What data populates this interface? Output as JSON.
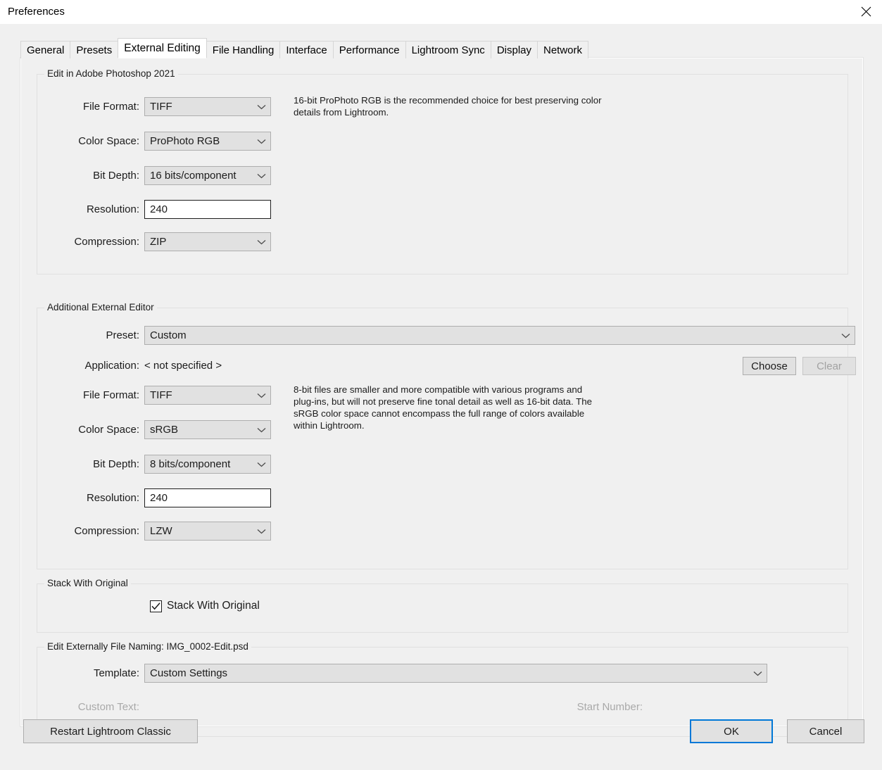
{
  "window": {
    "title": "Preferences",
    "close_icon": "close-icon"
  },
  "tabs": [
    {
      "label": "General",
      "active": false
    },
    {
      "label": "Presets",
      "active": false
    },
    {
      "label": "External Editing",
      "active": true
    },
    {
      "label": "File Handling",
      "active": false
    },
    {
      "label": "Interface",
      "active": false
    },
    {
      "label": "Performance",
      "active": false
    },
    {
      "label": "Lightroom Sync",
      "active": false
    },
    {
      "label": "Display",
      "active": false
    },
    {
      "label": "Network",
      "active": false
    }
  ],
  "photoshop_group": {
    "title": "Edit in Adobe Photoshop 2021",
    "description": "16-bit ProPhoto RGB is the recommended choice for best preserving color details from Lightroom.",
    "file_format": {
      "label": "File Format:",
      "value": "TIFF"
    },
    "color_space": {
      "label": "Color Space:",
      "value": "ProPhoto RGB"
    },
    "bit_depth": {
      "label": "Bit Depth:",
      "value": "16 bits/component"
    },
    "resolution": {
      "label": "Resolution:",
      "value": "240"
    },
    "compression": {
      "label": "Compression:",
      "value": "ZIP"
    }
  },
  "additional_editor_group": {
    "title": "Additional External Editor",
    "description": "8-bit files are smaller and more compatible with various programs and plug-ins, but will not preserve fine tonal detail as well as 16-bit data. The sRGB color space cannot encompass the full range of colors available within Lightroom.",
    "preset": {
      "label": "Preset:",
      "value": "Custom"
    },
    "application": {
      "label": "Application:",
      "value": "< not specified >"
    },
    "choose_button": "Choose",
    "clear_button": "Clear",
    "file_format": {
      "label": "File Format:",
      "value": "TIFF"
    },
    "color_space": {
      "label": "Color Space:",
      "value": "sRGB"
    },
    "bit_depth": {
      "label": "Bit Depth:",
      "value": "8 bits/component"
    },
    "resolution": {
      "label": "Resolution:",
      "value": "240"
    },
    "compression": {
      "label": "Compression:",
      "value": "LZW"
    }
  },
  "stack_group": {
    "title": "Stack With Original",
    "checkbox_label": "Stack With Original",
    "checked": true
  },
  "naming_group": {
    "title": "Edit Externally File Naming:  IMG_0002-Edit.psd",
    "template": {
      "label": "Template:",
      "value": "Custom Settings"
    },
    "custom_text": {
      "label": "Custom Text:",
      "value": ""
    },
    "start_number": {
      "label": "Start Number:",
      "value": ""
    }
  },
  "footer": {
    "restart_button": "Restart Lightroom Classic",
    "ok_button": "OK",
    "cancel_button": "Cancel"
  },
  "colors": {
    "accent": "#0078d7",
    "dialog_bg": "#f0f0f0",
    "control_bg": "#e1e1e1",
    "disabled_text": "#a9a9a9"
  }
}
